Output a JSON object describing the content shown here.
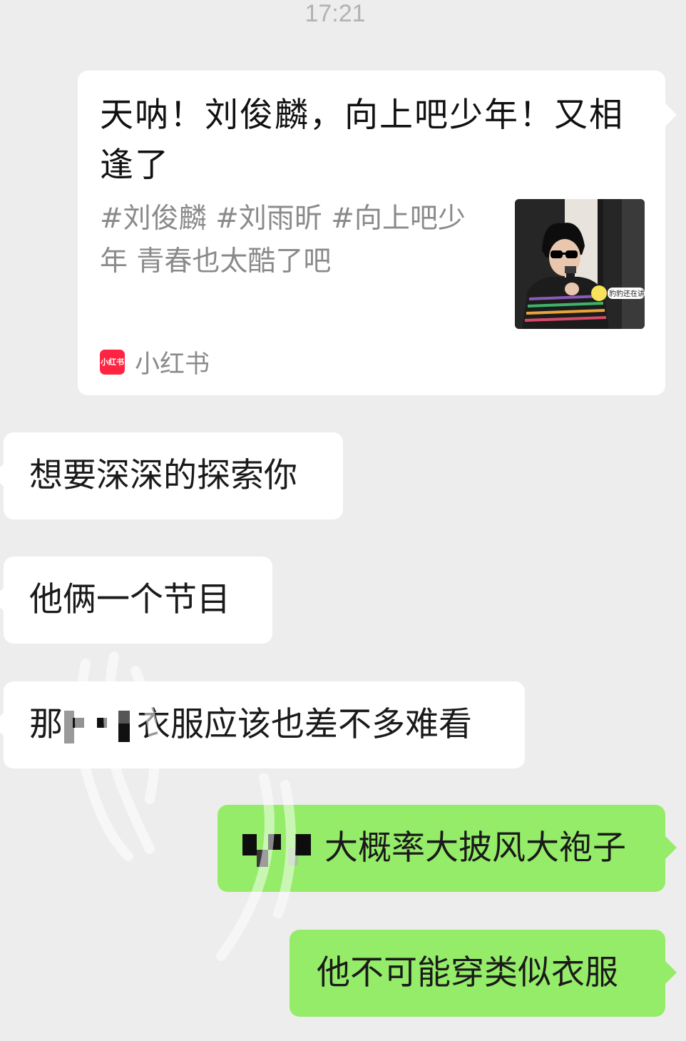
{
  "status": {
    "time": "17:21"
  },
  "messages": [
    {
      "type": "link-card",
      "direction": "incoming",
      "title": "天呐！刘俊麟，向上吧少年！又相逢了",
      "description": "#刘俊麟 #刘雨昕 #向上吧少年 青春也太酷了吧",
      "thumbnail_caption": "豹豹还在讲",
      "source_logo_text": "小红书",
      "source_name": "小红书"
    },
    {
      "type": "text",
      "direction": "incoming",
      "text": "想要深深的探索你"
    },
    {
      "type": "text",
      "direction": "incoming",
      "text": "他俩一个节目"
    },
    {
      "type": "text",
      "direction": "incoming",
      "text_start": "那",
      "text_end": "衣服应该也差不多难看"
    },
    {
      "type": "text",
      "direction": "outgoing",
      "text": "大概率大披风大袍子"
    },
    {
      "type": "text",
      "direction": "outgoing",
      "text": "他不可能穿类似衣服"
    }
  ],
  "colors": {
    "chat_background": "#ededed",
    "incoming_bubble": "#ffffff",
    "outgoing_bubble": "#95ec69",
    "timestamp": "#b2b2b2",
    "app_brand": "#ff2442"
  }
}
